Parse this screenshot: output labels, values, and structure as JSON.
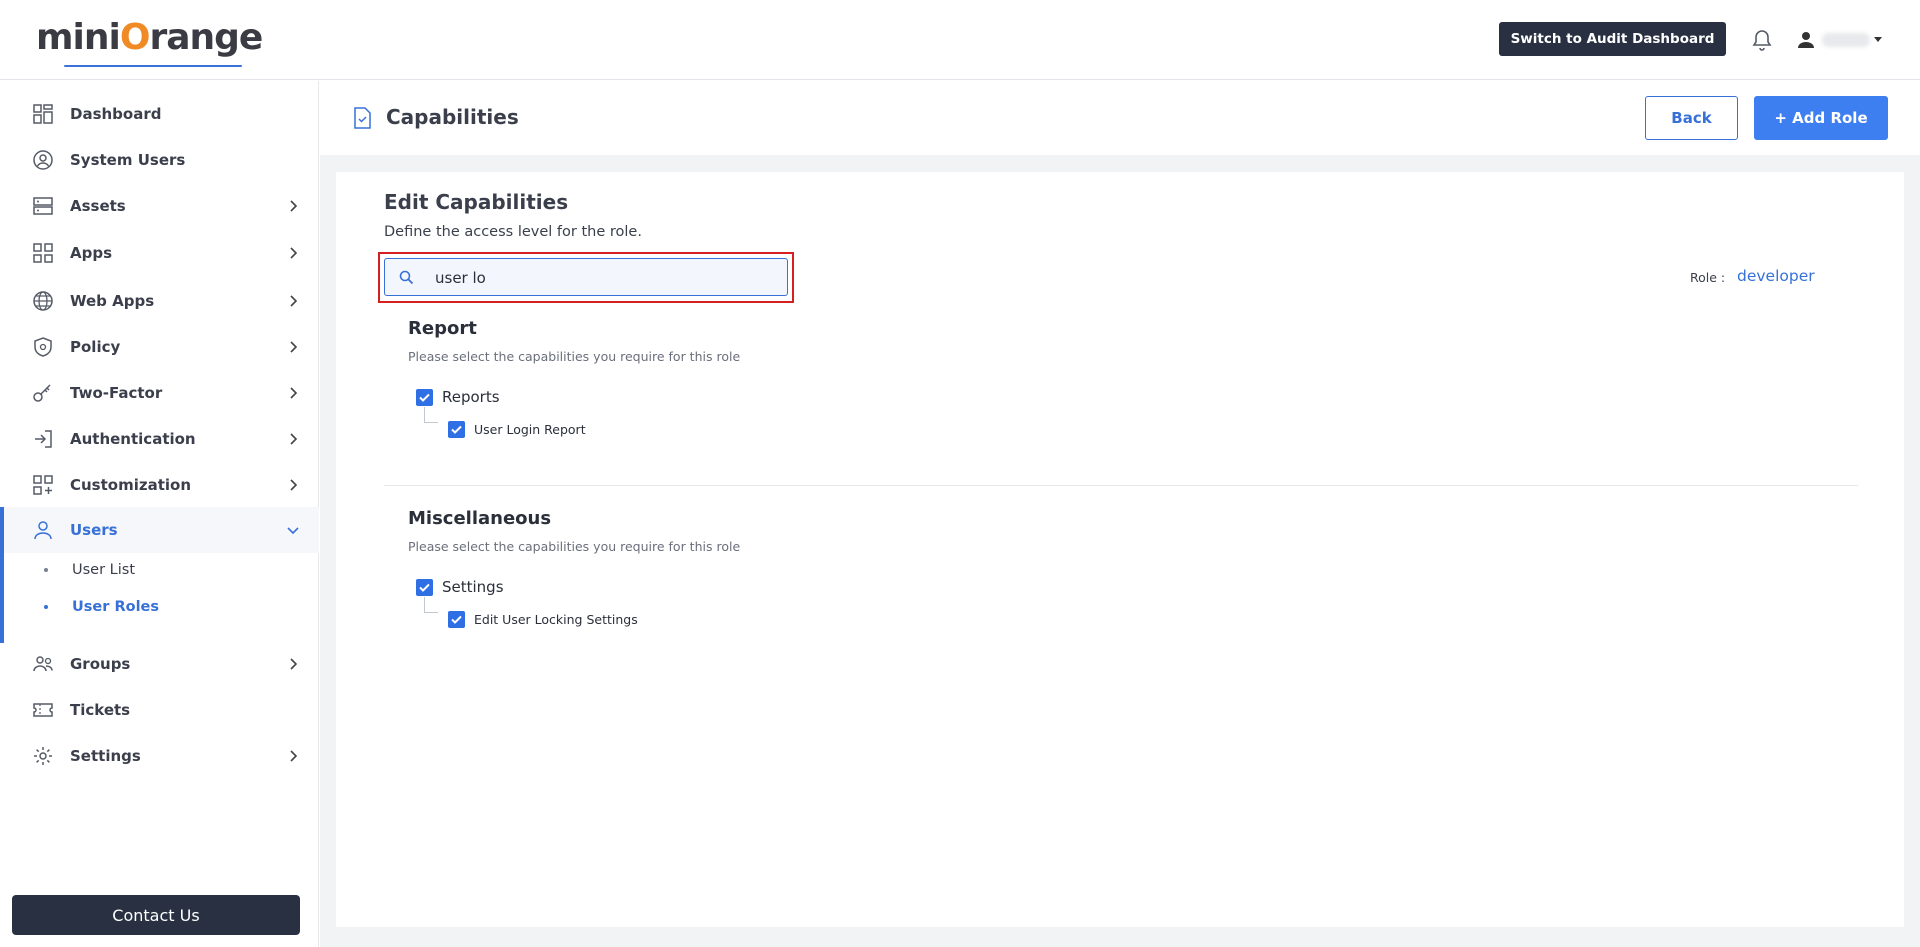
{
  "header": {
    "logo_prefix": "mini",
    "logo_o": "O",
    "logo_suffix": "range",
    "audit_button": "Switch to Audit Dashboard",
    "bell_icon": "bell-icon",
    "user_icon": "user-icon"
  },
  "sidebar": {
    "items": [
      {
        "label": "Dashboard",
        "icon": "dashboard-icon"
      },
      {
        "label": "System Users",
        "icon": "user-circle-icon"
      },
      {
        "label": "Assets",
        "icon": "server-icon"
      },
      {
        "label": "Apps",
        "icon": "apps-grid-icon"
      },
      {
        "label": "Web Apps",
        "icon": "globe-icon"
      },
      {
        "label": "Policy",
        "icon": "shield-icon"
      },
      {
        "label": "Two-Factor",
        "icon": "key-icon"
      },
      {
        "label": "Authentication",
        "icon": "login-icon"
      },
      {
        "label": "Customization",
        "icon": "customization-icon"
      },
      {
        "label": "Users",
        "icon": "user-icon"
      },
      {
        "label": "Groups",
        "icon": "groups-icon"
      },
      {
        "label": "Tickets",
        "icon": "ticket-icon"
      },
      {
        "label": "Settings",
        "icon": "gear-icon"
      }
    ],
    "users_sub": [
      "User List",
      "User Roles"
    ],
    "contact_button": "Contact Us",
    "active_color": "#3771d8"
  },
  "page": {
    "title": "Capabilities",
    "back_button": "Back",
    "add_role_button": "+ Add Role"
  },
  "edit": {
    "title": "Edit Capabilities",
    "subtitle": "Define the access level for the role.",
    "search_value": "user lo",
    "role_label": "Role :",
    "role_value": "developer"
  },
  "sections": [
    {
      "title": "Report",
      "subtitle": "Please select the capabilities you require for this role",
      "parent": "Reports",
      "child": "User Login Report"
    },
    {
      "title": "Miscellaneous",
      "subtitle": "Please select the capabilities you require for this role",
      "parent": "Settings",
      "child": "Edit User Locking Settings"
    }
  ],
  "colors": {
    "primary": "#3d7ff0",
    "dark_button": "#283042",
    "highlight": "#d42020",
    "checkbox": "#2f6fe4"
  }
}
